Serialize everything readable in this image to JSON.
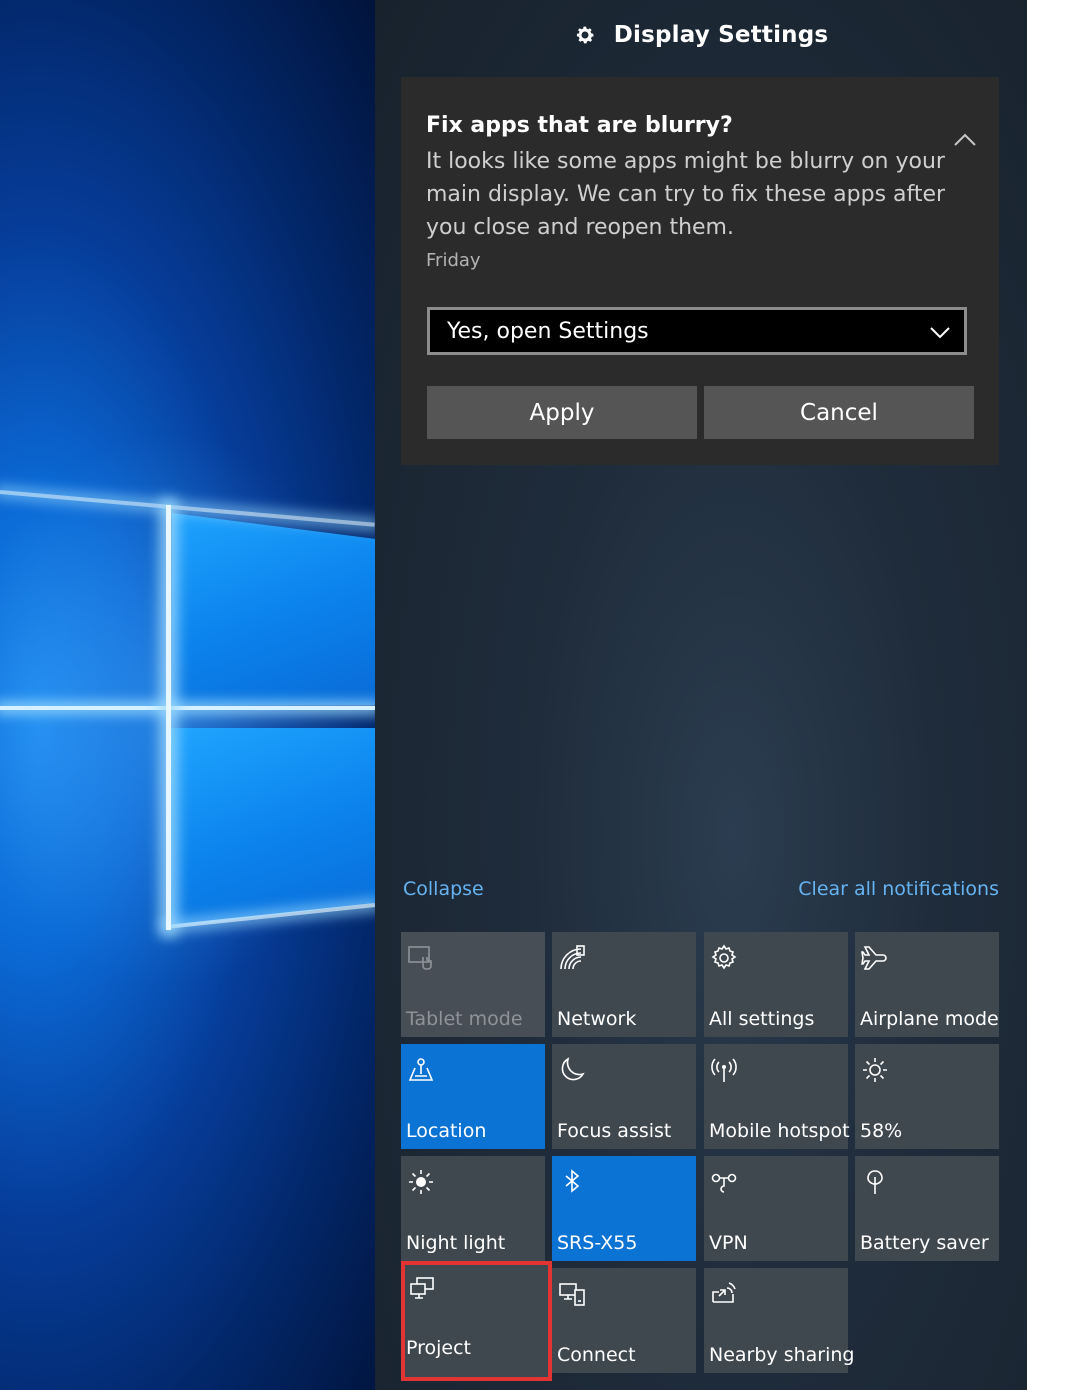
{
  "header": {
    "title": "Display Settings",
    "icon": "gear-icon"
  },
  "notification": {
    "title": "Fix apps that are blurry?",
    "body": "It looks like some apps might be blurry on your main display. We can try to fix these apps after you close and reopen them.",
    "time": "Friday",
    "dropdown_value": "Yes, open Settings",
    "apply_label": "Apply",
    "cancel_label": "Cancel"
  },
  "links": {
    "collapse": "Collapse",
    "clear_all": "Clear all notifications"
  },
  "quick_actions": [
    {
      "label": "Tablet mode",
      "icon": "tablet-mode-icon",
      "state": "disabled"
    },
    {
      "label": "Network",
      "icon": "network-icon",
      "state": "off"
    },
    {
      "label": "All settings",
      "icon": "gear-icon",
      "state": "off"
    },
    {
      "label": "Airplane mode",
      "icon": "airplane-icon",
      "state": "off"
    },
    {
      "label": "Location",
      "icon": "location-icon",
      "state": "on"
    },
    {
      "label": "Focus assist",
      "icon": "moon-icon",
      "state": "off"
    },
    {
      "label": "Mobile hotspot",
      "icon": "hotspot-icon",
      "state": "off"
    },
    {
      "label": "58%",
      "icon": "brightness-icon",
      "state": "off"
    },
    {
      "label": "Night light",
      "icon": "night-light-icon",
      "state": "off"
    },
    {
      "label": "SRS-X55",
      "icon": "bluetooth-icon",
      "state": "on"
    },
    {
      "label": "VPN",
      "icon": "vpn-icon",
      "state": "off"
    },
    {
      "label": "Battery saver",
      "icon": "battery-saver-icon",
      "state": "off"
    },
    {
      "label": "Project",
      "icon": "project-icon",
      "state": "off",
      "highlighted": true
    },
    {
      "label": "Connect",
      "icon": "connect-icon",
      "state": "off"
    },
    {
      "label": "Nearby sharing",
      "icon": "nearby-sharing-icon",
      "state": "off"
    }
  ],
  "colors": {
    "accent": "#0b73d4",
    "link": "#66b3f2",
    "highlight_border": "#e33434",
    "tile_bg": "#3f474f"
  }
}
